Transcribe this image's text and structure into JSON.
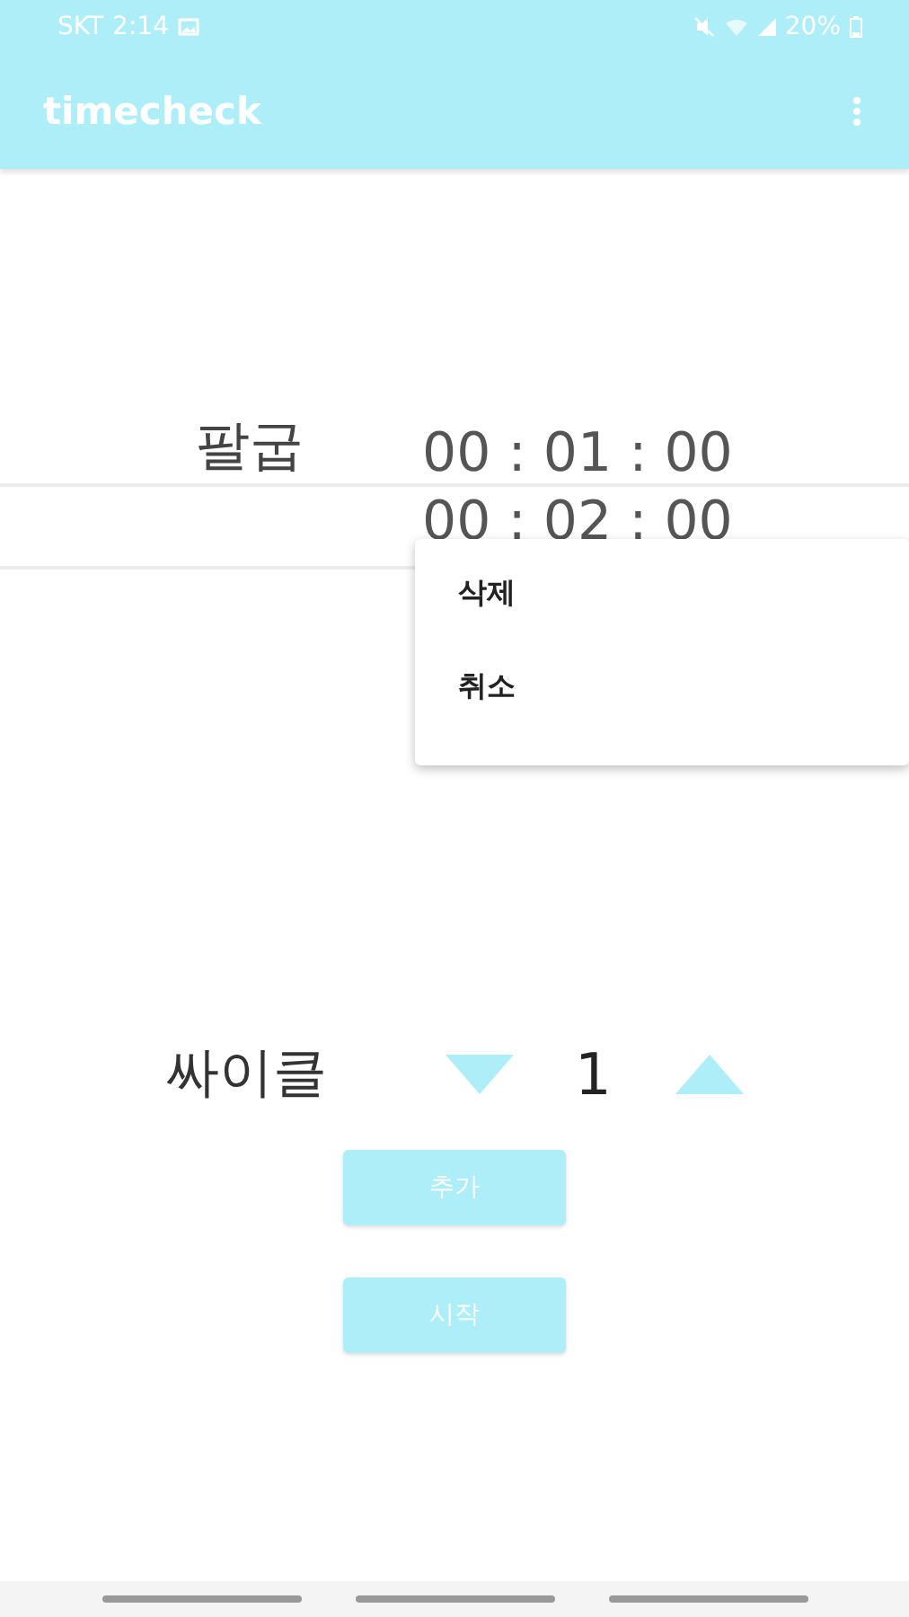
{
  "status_bar": {
    "carrier": "SKT",
    "time": "2:14",
    "battery": "20%"
  },
  "app_bar": {
    "title": "timecheck"
  },
  "timers": [
    {
      "name": "팔굽",
      "time": "00 : 01 : 00"
    },
    {
      "time": "00 : 02 : 00"
    }
  ],
  "context_menu": {
    "items": [
      "삭제",
      "취소"
    ]
  },
  "cycle": {
    "label": "싸이클",
    "value": "1"
  },
  "buttons": [
    "추가",
    "시작"
  ]
}
